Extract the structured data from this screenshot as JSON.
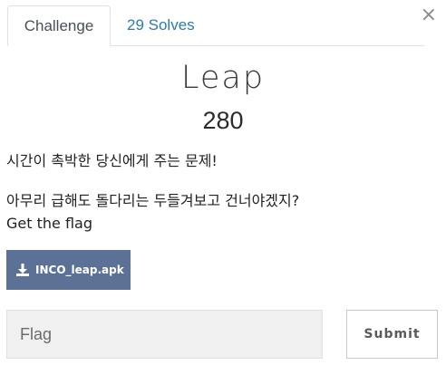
{
  "tabs": {
    "challenge_label": "Challenge",
    "solves_label": "29 Solves"
  },
  "close_label": "×",
  "challenge": {
    "name": "Leap",
    "points": "280",
    "description_lines": [
      "시간이 촉박한 당신에게 주는 문제!",
      "아무리 급해도 돌다리는 두들겨보고 건너야겠지?",
      "Get the flag"
    ]
  },
  "file": {
    "label": "INCO_leap.apk",
    "icon": "download-icon"
  },
  "flag_form": {
    "placeholder": "Flag",
    "value": "",
    "submit_label": "Submit"
  },
  "colors": {
    "tab_link": "#2a7ab9",
    "file_button": "#5c7196",
    "input_bg": "#f0f0f0"
  }
}
